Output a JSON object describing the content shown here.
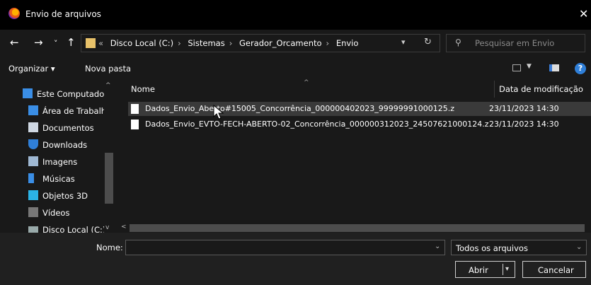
{
  "window": {
    "title": "Envio de arquivos",
    "close": "✕"
  },
  "nav": {
    "back": "←",
    "forward": "→",
    "recent": "˅",
    "up": "↑",
    "breadcrumbs": [
      "Disco Local (C:)",
      "Sistemas",
      "Gerador_Orcamento",
      "Envio"
    ],
    "overflow": "«",
    "search_placeholder": "Pesquisar em Envio"
  },
  "toolbar": {
    "organize": "Organizar ▾",
    "new_folder": "Nova pasta",
    "help": "?"
  },
  "sidebar": {
    "items": [
      {
        "label": "Este Computador",
        "icon": "computer-icon"
      },
      {
        "label": "Área de Trabalho",
        "icon": "desktop-icon"
      },
      {
        "label": "Documentos",
        "icon": "documents-icon"
      },
      {
        "label": "Downloads",
        "icon": "downloads-icon"
      },
      {
        "label": "Imagens",
        "icon": "pictures-icon"
      },
      {
        "label": "Músicas",
        "icon": "music-icon"
      },
      {
        "label": "Objetos 3D",
        "icon": "objects-3d-icon"
      },
      {
        "label": "Vídeos",
        "icon": "videos-icon"
      },
      {
        "label": "Disco Local (C:)",
        "icon": "drive-icon"
      }
    ]
  },
  "files": {
    "columns": {
      "name": "Nome",
      "date": "Data de modificação"
    },
    "rows": [
      {
        "name": "Dados_Envio_Aberto#15005_Concorrência_000000402023_99999991000125.z",
        "date": "23/11/2023 14:30",
        "selected": true
      },
      {
        "name": "Dados_Envio_EVTO-FECH-ABERTO-02_Concorrência_000000312023_24507621000124.z",
        "date": "23/11/2023 14:30",
        "selected": false
      }
    ]
  },
  "bottom": {
    "filename_label": "Nome:",
    "filename_value": "",
    "filetype": "Todos os arquivos",
    "open": "Abrir",
    "cancel": "Cancelar"
  },
  "colors": {
    "accent": "#2f7fd8",
    "folder": "#e8c26a"
  }
}
